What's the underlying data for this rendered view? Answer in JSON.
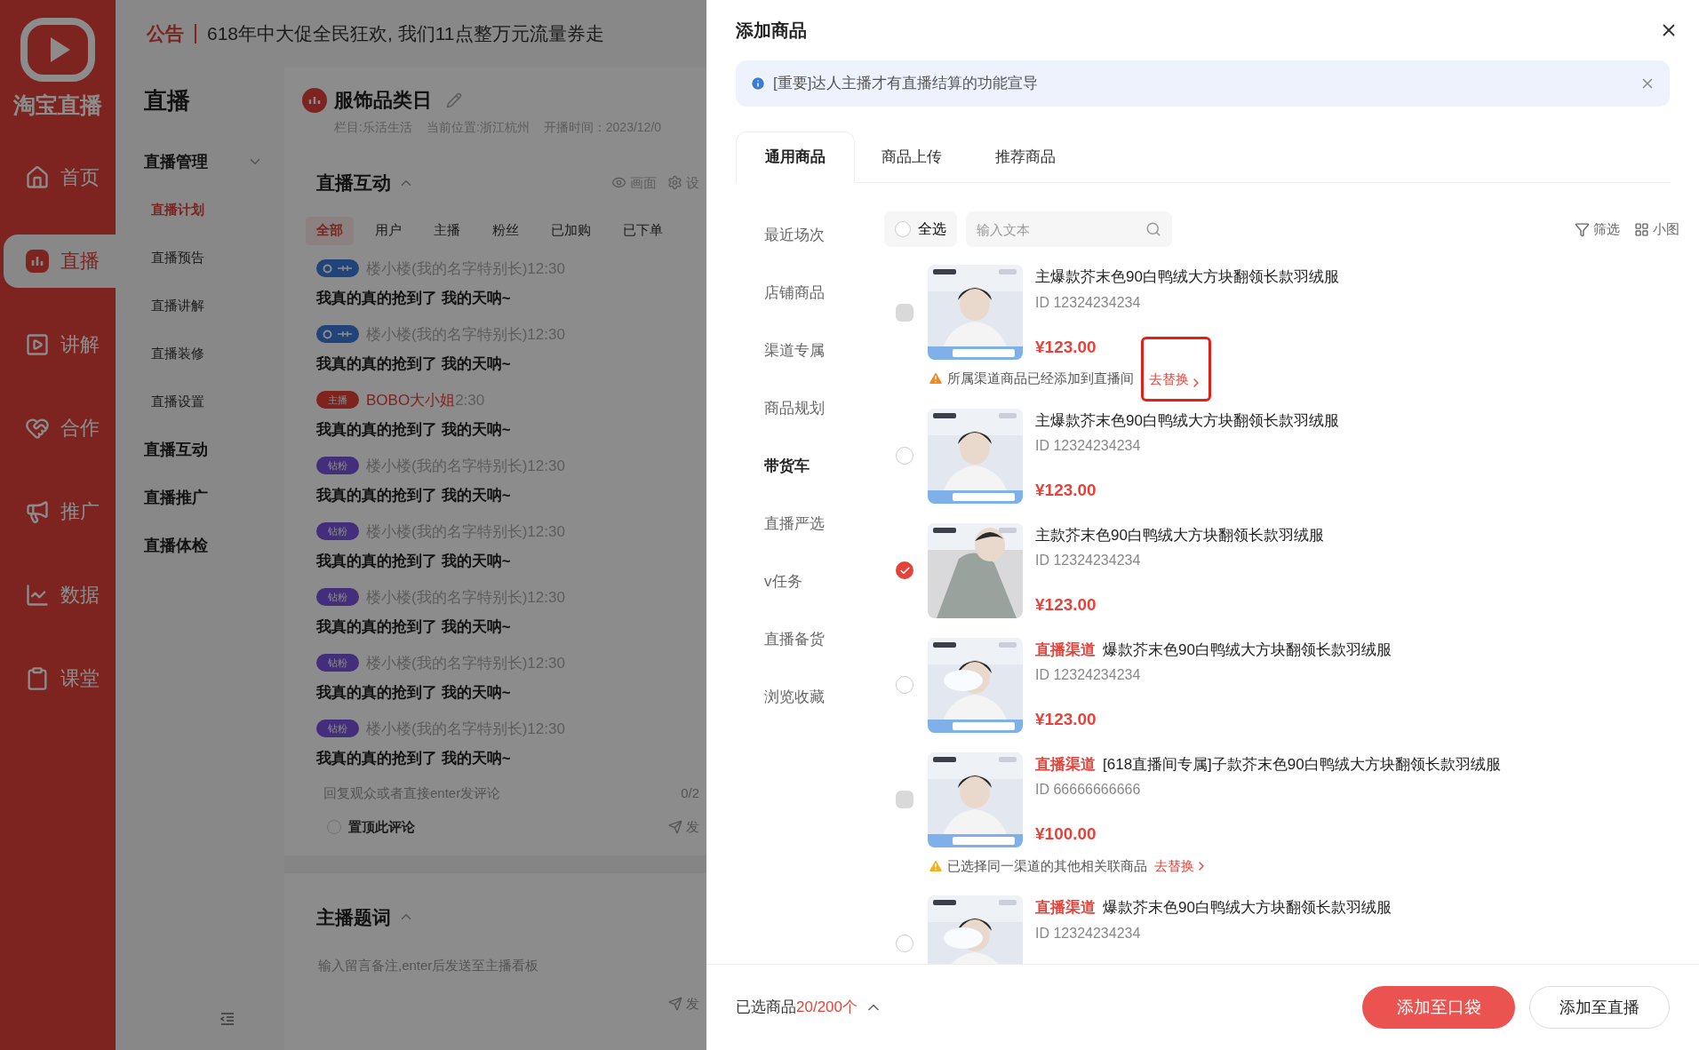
{
  "app": {
    "logo": "淘宝直播",
    "nav": [
      {
        "label": "首页",
        "selected": false
      },
      {
        "label": "直播",
        "selected": true
      },
      {
        "label": "讲解",
        "selected": false
      },
      {
        "label": "合作",
        "selected": false
      },
      {
        "label": "推广",
        "selected": false
      },
      {
        "label": "数据",
        "selected": false
      },
      {
        "label": "课堂",
        "selected": false
      }
    ],
    "panel": {
      "title": "直播",
      "groups": [
        {
          "label": "直播管理",
          "expanded": true,
          "children": [
            {
              "label": "直播计划",
              "selected": true
            },
            {
              "label": "直播预告",
              "selected": false
            },
            {
              "label": "直播讲解",
              "selected": false
            },
            {
              "label": "直播装修",
              "selected": false
            },
            {
              "label": "直播设置",
              "selected": false
            }
          ]
        },
        {
          "label": "直播互动"
        },
        {
          "label": "直播推广"
        },
        {
          "label": "直播体检"
        }
      ]
    },
    "notice": {
      "tag": "公告",
      "text": "618年中大促全民狂欢, 我们11点整万元流量券走"
    },
    "show": {
      "title": "服饰品类日",
      "meta": [
        "栏目:乐活生活",
        "当前位置:浙江杭州",
        "开播时间：2023/12/0"
      ]
    },
    "interaction": {
      "title": "直播互动",
      "expanded": true,
      "actions": [
        "画面",
        "设"
      ],
      "filters": [
        {
          "label": "全部",
          "selected": true
        },
        {
          "label": "用户",
          "selected": false
        },
        {
          "label": "主播",
          "selected": false
        },
        {
          "label": "粉丝",
          "selected": false
        },
        {
          "label": "已加购",
          "selected": false
        },
        {
          "label": "已下单",
          "selected": false
        }
      ],
      "comments": [
        {
          "kind": "user",
          "name": "楼小楼(我的名字特别长)",
          "time": "12:30",
          "text": "我真的真的抢到了 我的天呐~"
        },
        {
          "kind": "user",
          "name": "楼小楼(我的名字特别长)",
          "time": "12:30",
          "text": "我真的真的抢到了 我的天呐~"
        },
        {
          "kind": "host",
          "badge": "主播",
          "name": "BOBO大小姐",
          "time": "2:30",
          "text": "我真的真的抢到了 我的天呐~"
        },
        {
          "kind": "fan",
          "badge": "钻粉",
          "name": "楼小楼(我的名字特别长)",
          "time": "12:30",
          "text": "我真的真的抢到了 我的天呐~"
        },
        {
          "kind": "fan",
          "badge": "钻粉",
          "name": "楼小楼(我的名字特别长)",
          "time": "12:30",
          "text": "我真的真的抢到了 我的天呐~"
        },
        {
          "kind": "fan",
          "badge": "钻粉",
          "name": "楼小楼(我的名字特别长)",
          "time": "12:30",
          "text": "我真的真的抢到了 我的天呐~"
        },
        {
          "kind": "fan",
          "badge": "钻粉",
          "name": "楼小楼(我的名字特别长)",
          "time": "12:30",
          "text": "我真的真的抢到了 我的天呐~"
        },
        {
          "kind": "fan",
          "badge": "钻粉",
          "name": "楼小楼(我的名字特别长)",
          "time": "12:30",
          "text": "我真的真的抢到了 我的天呐~"
        }
      ],
      "reply": {
        "placeholder": "回复观众或者直接enter发评论",
        "counter": "0/2",
        "pin": {
          "label": "置顶此评论",
          "checked": false
        },
        "send": "发"
      }
    },
    "prompter": {
      "title": "主播题词",
      "expanded": true,
      "placeholder": "输入留言备注,enter后发送至主播看板",
      "send": "发"
    }
  },
  "drawer": {
    "title": "添加商品",
    "alert": "[重要]达人主播才有直播结算的功能宣导",
    "tabs": [
      {
        "label": "通用商品",
        "selected": true
      },
      {
        "label": "商品上传",
        "selected": false
      },
      {
        "label": "推荐商品",
        "selected": false
      }
    ],
    "categories": [
      {
        "label": "最近场次",
        "selected": false
      },
      {
        "label": "店铺商品",
        "selected": false
      },
      {
        "label": "渠道专属",
        "selected": false
      },
      {
        "label": "商品规划",
        "selected": false
      },
      {
        "label": "带货车",
        "selected": true
      },
      {
        "label": "直播严选",
        "selected": false
      },
      {
        "label": "v任务",
        "selected": false
      },
      {
        "label": "直播备货",
        "selected": false
      },
      {
        "label": "浏览收藏",
        "selected": false
      }
    ],
    "select_all": {
      "label": "全选",
      "checked": false
    },
    "search": {
      "placeholder": "输入文本"
    },
    "tools": [
      "筛选",
      "小图"
    ],
    "products": [
      {
        "checked": false,
        "disabled": true,
        "title": "主爆款芥末色90白鸭绒大方块翻领长款羽绒服",
        "id": "ID 12324234234",
        "price": "¥123.00",
        "warning": {
          "text": "所属渠道商品已经添加到直播间",
          "link": "去替换",
          "highlighted": true
        }
      },
      {
        "checked": false,
        "disabled": false,
        "title": "主爆款芥末色90白鸭绒大方块翻领长款羽绒服",
        "id": "ID 12324234234",
        "price": "¥123.00"
      },
      {
        "checked": true,
        "disabled": false,
        "title": "主款芥末色90白鸭绒大方块翻领长款羽绒服",
        "id": "ID 12324234234",
        "price": "¥123.00"
      },
      {
        "checked": false,
        "disabled": false,
        "tag": "直播渠道",
        "title": "爆款芥末色90白鸭绒大方块翻领长款羽绒服",
        "id": "ID 12324234234",
        "price": "¥123.00"
      },
      {
        "checked": false,
        "disabled": true,
        "tag": "直播渠道",
        "title": "[618直播间专属]子款芥末色90白鸭绒大方块翻领长款羽绒服",
        "id": "ID 66666666666",
        "price": "¥100.00",
        "warning": {
          "text": "已选择同一渠道的其他相关联商品",
          "link": "去替换",
          "highlighted": false
        }
      },
      {
        "checked": false,
        "disabled": false,
        "tag": "直播渠道",
        "title": "爆款芥末色90白鸭绒大方块翻领长款羽绒服",
        "id": "ID 12324234234"
      }
    ],
    "footer": {
      "label": "已选商品",
      "count": "20/200个",
      "buttons": [
        {
          "label": "添加至口袋",
          "primary": true
        },
        {
          "label": "添加至直播",
          "primary": false
        }
      ]
    }
  }
}
